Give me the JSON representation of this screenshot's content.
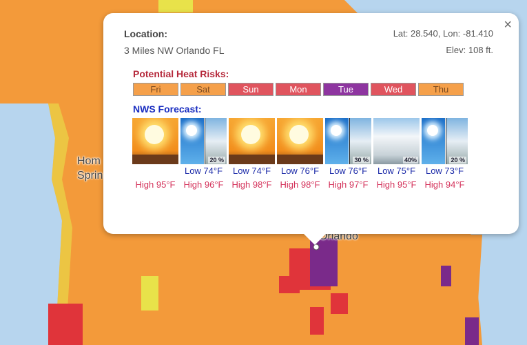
{
  "map": {
    "labels": {
      "home": "Hom",
      "spring": "Sprin",
      "orlando": "Orlando"
    },
    "colors": {
      "land": "#f39a3a",
      "water": "#b7d5ee",
      "yellow": "#e8e24a",
      "red": "#e0343a",
      "purple": "#7a2a8a"
    }
  },
  "popup": {
    "close": "×",
    "location_label": "Location:",
    "location_name": "3 Miles NW Orlando FL",
    "latlon": "Lat: 28.540, Lon: -81.410",
    "elevation": "Elev: 108 ft.",
    "heat_risk_title": "Potential Heat Risks:",
    "heat_risks": [
      {
        "day": "Fri",
        "color": "#f5a04a",
        "text": "#7a4a20"
      },
      {
        "day": "Sat",
        "color": "#f5a04a",
        "text": "#7a4a20"
      },
      {
        "day": "Sun",
        "color": "#e0545e",
        "text": "#ffffff"
      },
      {
        "day": "Mon",
        "color": "#e0545e",
        "text": "#ffffff"
      },
      {
        "day": "Tue",
        "color": "#8e35a0",
        "text": "#ffffff"
      },
      {
        "day": "Wed",
        "color": "#e0545e",
        "text": "#ffffff"
      },
      {
        "day": "Thu",
        "color": "#f5a04a",
        "text": "#7a4a20"
      }
    ],
    "forecast_title": "NWS Forecast:",
    "forecast": [
      {
        "icon": "hot-sunny",
        "pct": "",
        "low": "",
        "high": "High 95°F"
      },
      {
        "icon": "sunny-then-chance-tstorm",
        "pct": "20 %",
        "low": "Low 74°F",
        "high": "High 96°F"
      },
      {
        "icon": "hot-sunny",
        "pct": "",
        "low": "Low 74°F",
        "high": "High 98°F"
      },
      {
        "icon": "hot-sunny",
        "pct": "",
        "low": "Low 76°F",
        "high": "High 98°F"
      },
      {
        "icon": "sunny-then-chance-tstorm",
        "pct": "30 %",
        "low": "Low 76°F",
        "high": "High 97°F"
      },
      {
        "icon": "chance-tstorm",
        "pct": "40%",
        "low": "Low 75°F",
        "high": "High 95°F"
      },
      {
        "icon": "sunny-then-chance-tstorm",
        "pct": "20 %",
        "low": "Low 73°F",
        "high": "High 94°F"
      }
    ]
  }
}
